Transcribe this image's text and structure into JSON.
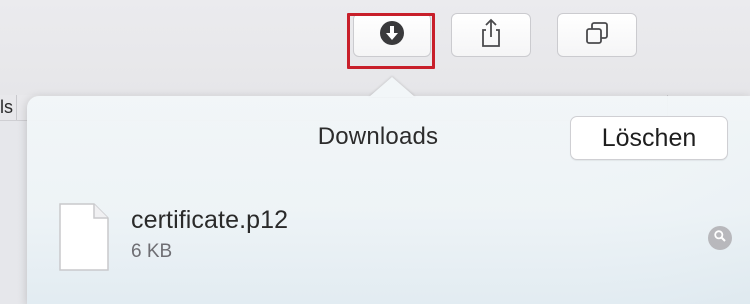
{
  "toolbar": {
    "buttons": [
      {
        "name": "downloads-button",
        "icon": "download-circle-icon",
        "highlighted": true,
        "highlight_color": "#c81f2a"
      },
      {
        "name": "share-button",
        "icon": "share-icon"
      },
      {
        "name": "tab-overview-button",
        "icon": "tabs-overview-icon"
      }
    ]
  },
  "tab_strip": {
    "partial_text": "ls"
  },
  "downloads_popover": {
    "title": "Downloads",
    "clear_label": "Löschen",
    "items": [
      {
        "file_name": "certificate.p12",
        "size": "6 KB",
        "file_icon": "document-icon",
        "reveal_icon": "magnifier-icon"
      }
    ]
  },
  "colors": {
    "highlight": "#c81f2a",
    "popover_bg": "#f2f6f8",
    "text_primary": "#2a2a2a",
    "text_secondary": "#6e6e73"
  }
}
